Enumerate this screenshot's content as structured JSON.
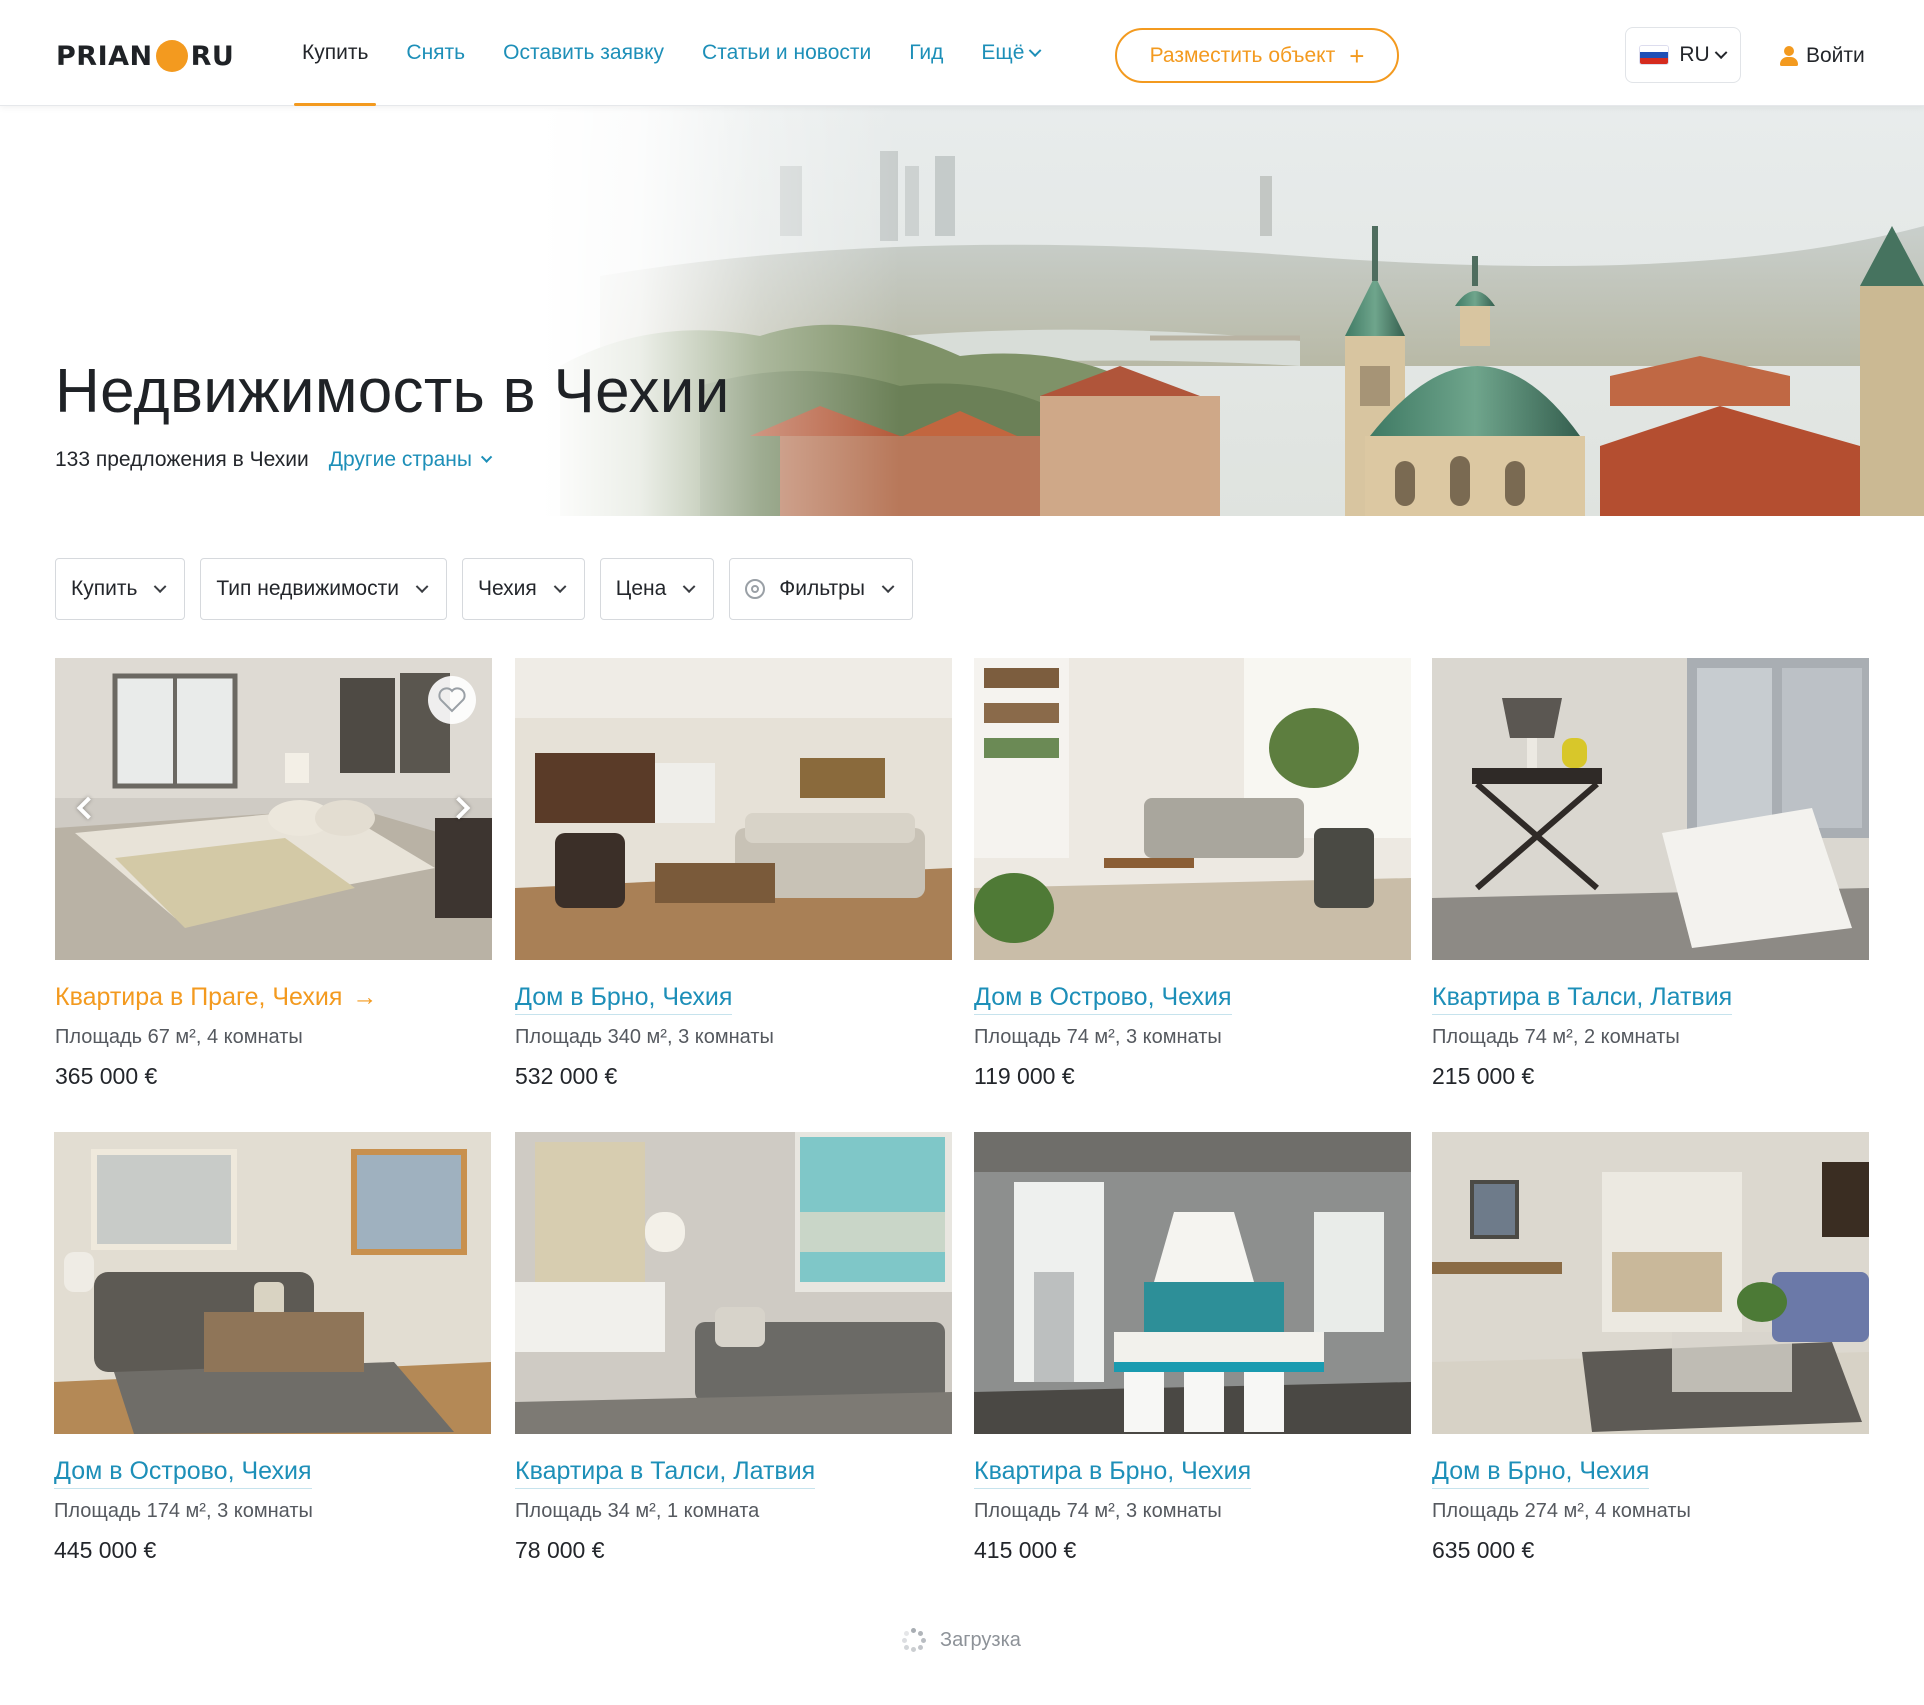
{
  "header": {
    "logo_left": "PRIAN",
    "logo_right": "RU",
    "nav": [
      "Купить",
      "Снять",
      "Оставить заявку",
      "Статьи и новости",
      "Гид",
      "Ещё"
    ],
    "active_nav": "Купить",
    "post_button": "Разместить объект",
    "post_button_icon": "plus-icon",
    "language": "RU",
    "login": "Войти"
  },
  "hero": {
    "title": "Недвижимость в Чехии",
    "count_text": "133 предложения в Чехии",
    "other_countries": "Другие страны"
  },
  "filters": [
    "Купить",
    "Тип недвижимости",
    "Чехия",
    "Цена",
    "Фильтры"
  ],
  "listings": [
    {
      "title": "Квартира в Праге, Чехия",
      "meta": "Площадь 67 м², 4 комнаты",
      "price": "365 000 €"
    },
    {
      "title": "Дом в Брно, Чехия",
      "meta": "Площадь 340 м², 3 комнаты",
      "price": "532 000 €"
    },
    {
      "title": "Дом в Острово, Чехия",
      "meta": "Площадь 74 м², 3 комнаты",
      "price": "119 000 €"
    },
    {
      "title": "Квартира в Талси, Латвия",
      "meta": "Площадь 74 м², 2 комнаты",
      "price": "215 000 €"
    },
    {
      "title": "Дом в Острово, Чехия",
      "meta": "Площадь 174 м², 3 комнаты",
      "price": "445 000 €"
    },
    {
      "title": "Квартира в Талси, Латвия",
      "meta": "Площадь 34 м², 1 комната",
      "price": "78 000 €"
    },
    {
      "title": "Квартира в Брно, Чехия",
      "meta": "Площадь 74 м², 3 комнаты",
      "price": "415 000 €"
    },
    {
      "title": "Дом в Брно, Чехия",
      "meta": "Площадь 274 м², 4 комнаты",
      "price": "635 000 €"
    }
  ],
  "loading_text": "Загрузка",
  "colors": {
    "accent": "#f39a1f",
    "link": "#1d8fb8",
    "text": "#23262b",
    "muted": "#55595f"
  }
}
